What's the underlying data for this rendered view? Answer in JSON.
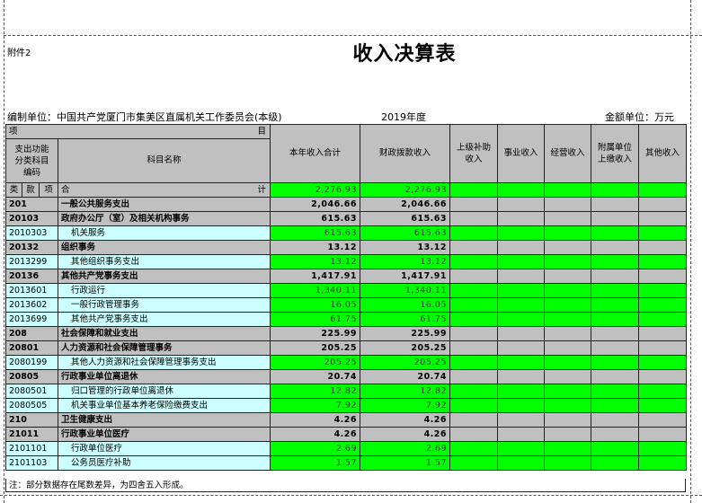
{
  "attachment": "附件2",
  "title": "收入决算表",
  "org_label": "编制单位：中国共产党厦门市集美区直属机关工作委员会(本级)",
  "year": "2019年度",
  "unit": "金额单位：万元",
  "header": {
    "xiang": "项",
    "mu": "目",
    "code_header": "支出功能分类科目编码",
    "name_header": "科目名称",
    "cols": [
      "本年收入合计",
      "财政拨款收入",
      "上级补助收入",
      "事业收入",
      "经营收入",
      "附属单位上缴收入",
      "其他收入"
    ],
    "lei": "类",
    "kuan": "款",
    "xiang2": "项",
    "he": "合",
    "ji": "计"
  },
  "total": {
    "amount": "2,276.93",
    "fiscal": "2,276.93"
  },
  "rows": [
    {
      "code": "201",
      "name": "一般公共服务支出",
      "amount": "2,046.66",
      "fiscal": "2,046.66",
      "level": 1
    },
    {
      "code": "20103",
      "name": "政府办公厅（室）及相关机构事务",
      "amount": "615.63",
      "fiscal": "615.63",
      "level": 1
    },
    {
      "code": "2010303",
      "name": "机关服务",
      "amount": "615.63",
      "fiscal": "615.63",
      "level": 3
    },
    {
      "code": "20132",
      "name": "组织事务",
      "amount": "13.12",
      "fiscal": "13.12",
      "level": 1
    },
    {
      "code": "2013299",
      "name": "其他组织事务支出",
      "amount": "13.12",
      "fiscal": "13.12",
      "level": 3
    },
    {
      "code": "20136",
      "name": "其他共产党事务支出",
      "amount": "1,417.91",
      "fiscal": "1,417.91",
      "level": 1
    },
    {
      "code": "2013601",
      "name": "行政运行",
      "amount": "1,340.11",
      "fiscal": "1,340.11",
      "level": 3
    },
    {
      "code": "2013602",
      "name": "一般行政管理事务",
      "amount": "16.05",
      "fiscal": "16.05",
      "level": 3
    },
    {
      "code": "2013699",
      "name": "其他共产党事务支出",
      "amount": "61.75",
      "fiscal": "61.75",
      "level": 3
    },
    {
      "code": "208",
      "name": "社会保障和就业支出",
      "amount": "225.99",
      "fiscal": "225.99",
      "level": 1
    },
    {
      "code": "20801",
      "name": "人力资源和社会保障管理事务",
      "amount": "205.25",
      "fiscal": "205.25",
      "level": 1
    },
    {
      "code": "2080199",
      "name": "其他人力资源和社会保障管理事务支出",
      "amount": "205.25",
      "fiscal": "205.25",
      "level": 3
    },
    {
      "code": "20805",
      "name": "行政事业单位离退休",
      "amount": "20.74",
      "fiscal": "20.74",
      "level": 1
    },
    {
      "code": "2080501",
      "name": "归口管理的行政单位离退休",
      "amount": "12.82",
      "fiscal": "12.82",
      "level": 3
    },
    {
      "code": "2080505",
      "name": "机关事业单位基本养老保险缴费支出",
      "amount": "7.92",
      "fiscal": "7.92",
      "level": 3
    },
    {
      "code": "210",
      "name": "卫生健康支出",
      "amount": "4.26",
      "fiscal": "4.26",
      "level": 1
    },
    {
      "code": "21011",
      "name": "行政事业单位医疗",
      "amount": "4.26",
      "fiscal": "4.26",
      "level": 1
    },
    {
      "code": "2101101",
      "name": "行政单位医疗",
      "amount": "2.69",
      "fiscal": "2.69",
      "level": 3
    },
    {
      "code": "2101103",
      "name": "公务员医疗补助",
      "amount": "1.57",
      "fiscal": "1.57",
      "level": 3
    }
  ],
  "note": "注：部分数据存在尾数差异，为四舍五入形成。"
}
